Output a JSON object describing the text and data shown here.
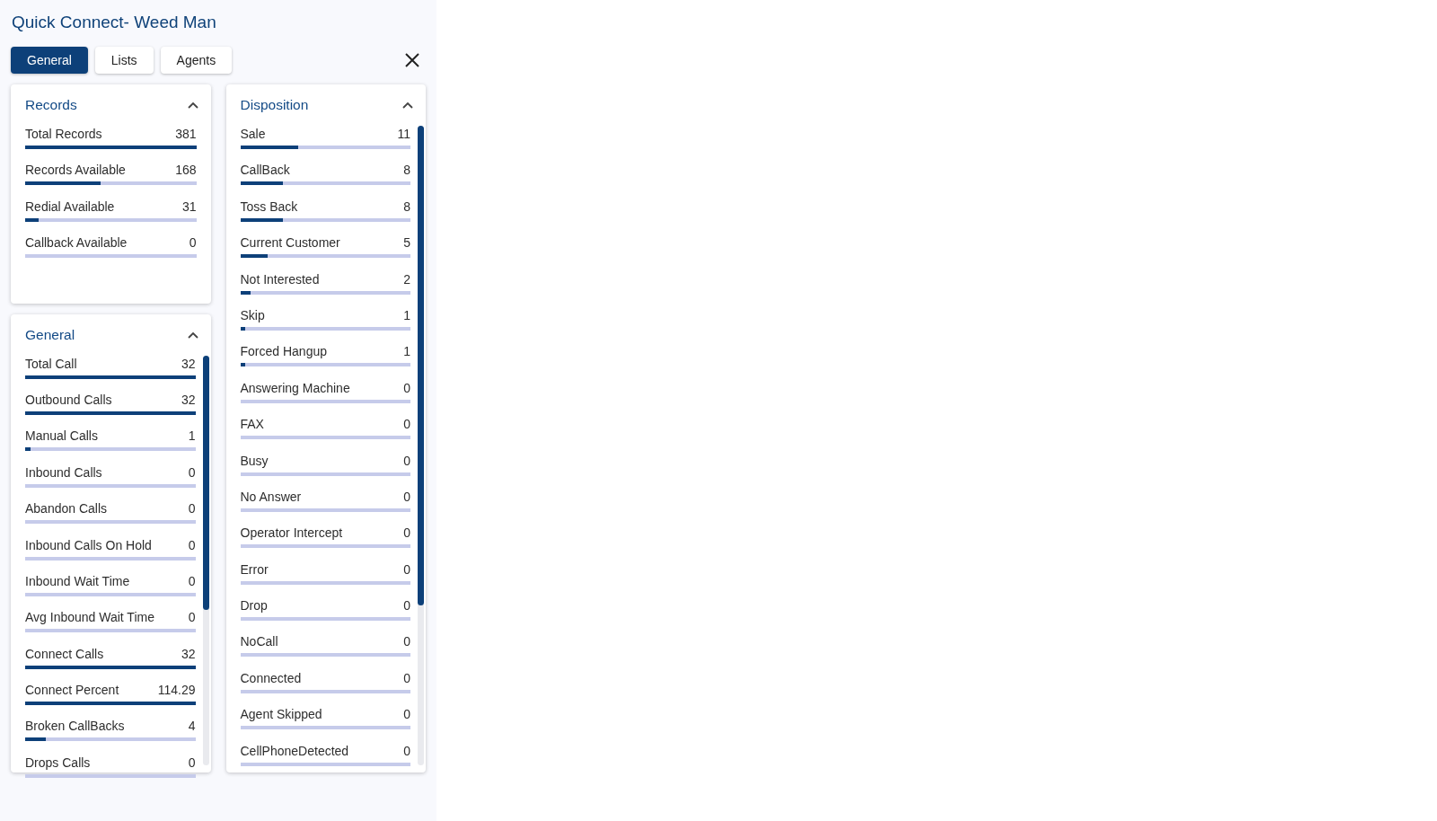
{
  "title": "Quick Connect- Weed Man",
  "tabs": [
    {
      "label": "General",
      "selected": true
    },
    {
      "label": "Lists",
      "selected": false
    },
    {
      "label": "Agents",
      "selected": false
    }
  ],
  "columns": [
    {
      "panels": [
        {
          "title": "Records",
          "expanded": true,
          "rows": [
            {
              "label": "Total Records",
              "value": "381",
              "level": 1
            },
            {
              "label": "Records Available",
              "value": "168",
              "level": 0.44
            },
            {
              "label": "Redial Available",
              "value": "31",
              "level": 0.08
            },
            {
              "label": "Callback Available",
              "value": "0",
              "level": 0
            }
          ]
        },
        {
          "title": "General",
          "expanded": true,
          "rows": [
            {
              "label": "Total Call",
              "value": "32",
              "level": 1
            },
            {
              "label": "Outbound Calls",
              "value": "32",
              "level": 1
            },
            {
              "label": "Manual Calls",
              "value": "1",
              "level": 0.03
            },
            {
              "label": "Inbound Calls",
              "value": "0",
              "level": 0
            },
            {
              "label": "Abandon Calls",
              "value": "0",
              "level": 0
            },
            {
              "label": "Inbound Calls On Hold",
              "value": "0",
              "level": 0
            },
            {
              "label": "Inbound Wait Time",
              "value": "0",
              "level": 0
            },
            {
              "label": "Avg Inbound Wait Time",
              "value": "0",
              "level": 0
            },
            {
              "label": "Connect Calls",
              "value": "32",
              "level": 1
            },
            {
              "label": "Connect Percent",
              "value": "114.29",
              "level": 1
            },
            {
              "label": "Broken CallBacks",
              "value": "4",
              "level": 0.12
            },
            {
              "label": "Drops Calls",
              "value": "0",
              "level": 0
            }
          ]
        }
      ]
    },
    {
      "panels": [
        {
          "title": "Disposition",
          "expanded": true,
          "rows": [
            {
              "label": "Sale",
              "value": "11",
              "level": 0.34
            },
            {
              "label": "CallBack",
              "value": "8",
              "level": 0.25
            },
            {
              "label": "Toss Back",
              "value": "8",
              "level": 0.25
            },
            {
              "label": "Current Customer",
              "value": "5",
              "level": 0.16
            },
            {
              "label": "Not Interested",
              "value": "2",
              "level": 0.06
            },
            {
              "label": "Skip",
              "value": "1",
              "level": 0.03
            },
            {
              "label": "Forced Hangup",
              "value": "1",
              "level": 0.03
            },
            {
              "label": "Answering Machine",
              "value": "0",
              "level": 0
            },
            {
              "label": "FAX",
              "value": "0",
              "level": 0
            },
            {
              "label": "Busy",
              "value": "0",
              "level": 0
            },
            {
              "label": "No Answer",
              "value": "0",
              "level": 0
            },
            {
              "label": "Operator Intercept",
              "value": "0",
              "level": 0
            },
            {
              "label": "Error",
              "value": "0",
              "level": 0
            },
            {
              "label": "Drop",
              "value": "0",
              "level": 0
            },
            {
              "label": "NoCall",
              "value": "0",
              "level": 0
            },
            {
              "label": "Connected",
              "value": "0",
              "level": 0
            },
            {
              "label": "Agent Skipped",
              "value": "0",
              "level": 0
            },
            {
              "label": "CellPhoneDetected",
              "value": "0",
              "level": 0
            }
          ]
        }
      ]
    }
  ]
}
